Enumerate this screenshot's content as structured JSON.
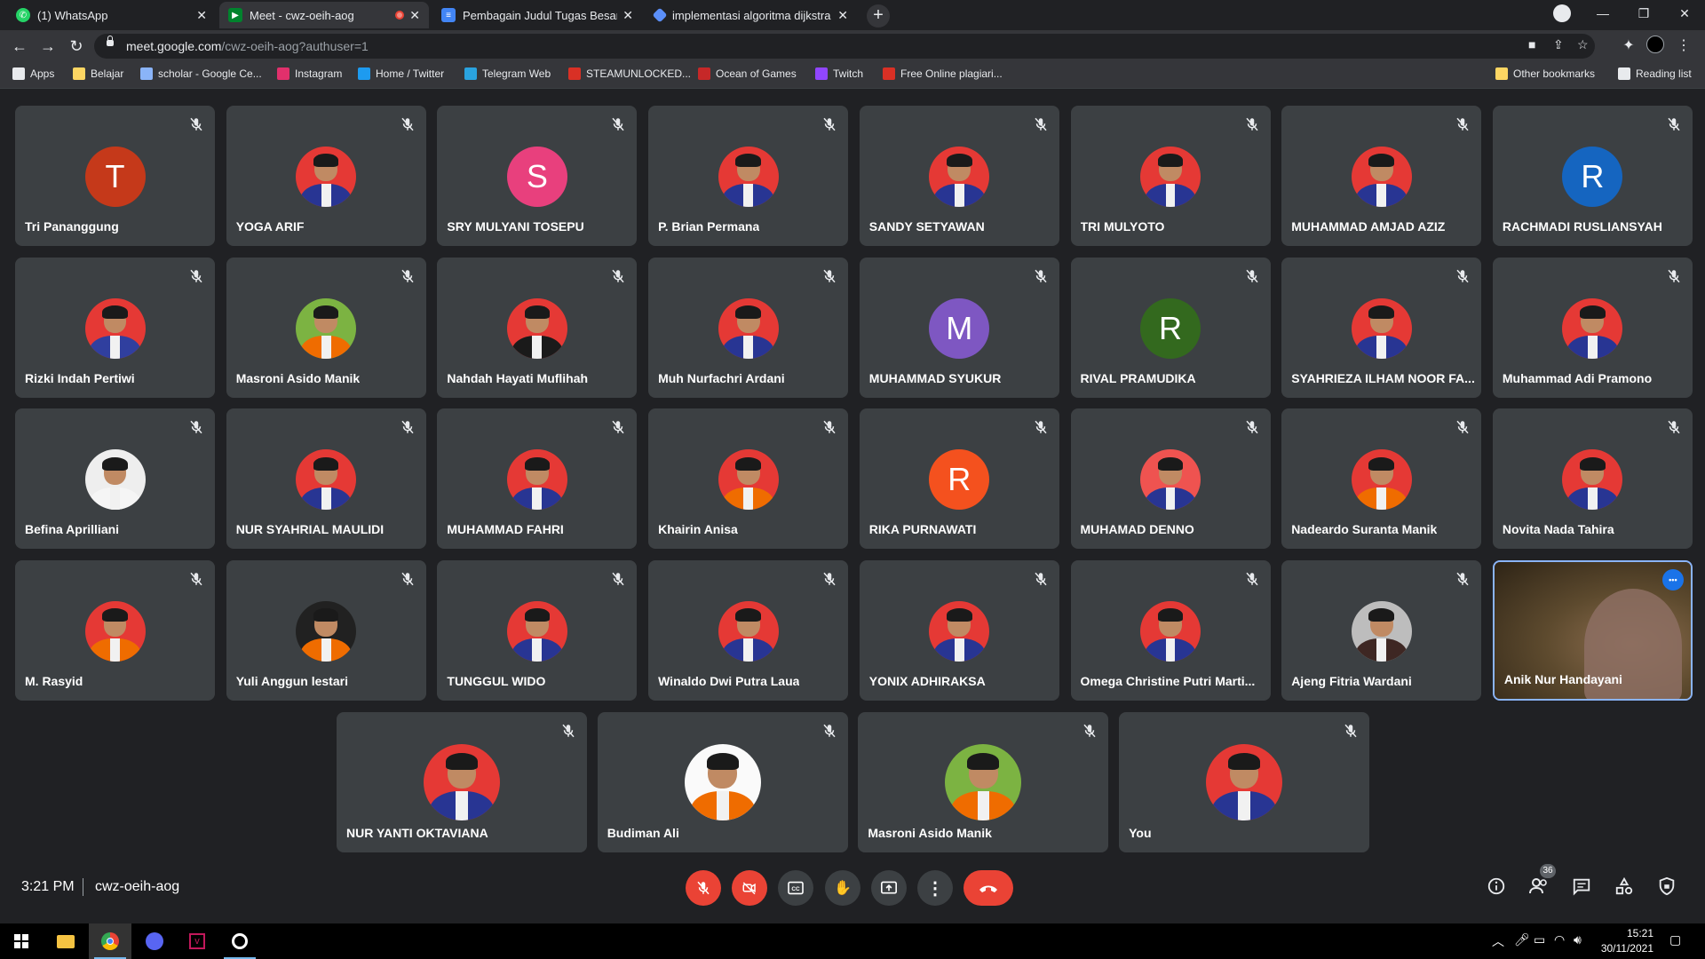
{
  "tabs": [
    {
      "label": "(1) WhatsApp",
      "icon": "whatsapp-icon",
      "color": "#25d366"
    },
    {
      "label": "Meet - cwz-oeih-aog",
      "icon": "meet-icon",
      "color": "#00832d"
    },
    {
      "label": "Pembagain Judul Tugas Besar Ke",
      "icon": "docs-icon",
      "color": "#4285f4"
    },
    {
      "label": "implementasi algoritma dijkstra",
      "icon": "dijkstra-icon",
      "color": "#5b8ff9"
    }
  ],
  "address": {
    "domain": "meet.google.com",
    "path": "/cwz-oeih-aog?authuser=1"
  },
  "bookmarks": [
    {
      "label": "Apps",
      "color": "#e8eaed"
    },
    {
      "label": "Belajar",
      "color": "#fdd663"
    },
    {
      "label": "scholar - Google Ce...",
      "color": "#8ab4f8"
    },
    {
      "label": "Instagram",
      "color": "#e1306c"
    },
    {
      "label": "Home / Twitter",
      "color": "#1d9bf0"
    },
    {
      "label": "Telegram Web",
      "color": "#2aa3df"
    },
    {
      "label": "STEAMUNLOCKED...",
      "color": "#d93025"
    },
    {
      "label": "Ocean of Games",
      "color": "#c62828"
    },
    {
      "label": "Twitch",
      "color": "#9146ff"
    },
    {
      "label": "Free Online plagiari...",
      "color": "#d93025"
    }
  ],
  "bookmarks_right": [
    {
      "label": "Other bookmarks",
      "color": "#fdd663"
    },
    {
      "label": "Reading list",
      "color": "#e8eaed"
    }
  ],
  "participants": [
    {
      "name": "Tri Pananggung",
      "avatar": "letter",
      "letter": "T",
      "color": "#c5391a"
    },
    {
      "name": "YOGA ARIF",
      "avatar": "photo",
      "bg": "#e53935",
      "body": "#283593"
    },
    {
      "name": "SRY MULYANI TOSEPU",
      "avatar": "letter",
      "letter": "S",
      "color": "#e8407d"
    },
    {
      "name": "P. Brian Permana",
      "avatar": "photo",
      "bg": "#e53935",
      "body": "#283593"
    },
    {
      "name": "SANDY SETYAWAN",
      "avatar": "photo",
      "bg": "#e53935",
      "body": "#283593"
    },
    {
      "name": "TRI MULYOTO",
      "avatar": "photo",
      "bg": "#e53935",
      "body": "#283593"
    },
    {
      "name": "MUHAMMAD AMJAD AZIZ",
      "avatar": "photo",
      "bg": "#e53935",
      "body": "#283593"
    },
    {
      "name": "RACHMADI RUSLIANSYAH",
      "avatar": "letter",
      "letter": "R",
      "color": "#1565c0"
    },
    {
      "name": "Rizki Indah Pertiwi",
      "avatar": "photo",
      "bg": "#e53935",
      "body": "#303f9f"
    },
    {
      "name": "Masroni Asido Manik",
      "avatar": "photo",
      "bg": "#7cb342",
      "body": "#ef6c00"
    },
    {
      "name": "Nahdah Hayati Muflihah",
      "avatar": "photo",
      "bg": "#e53935",
      "body": "#1a1a1a"
    },
    {
      "name": "Muh Nurfachri Ardani",
      "avatar": "photo",
      "bg": "#e53935",
      "body": "#283593"
    },
    {
      "name": "MUHAMMAD SYUKUR",
      "avatar": "letter",
      "letter": "M",
      "color": "#7e57c2"
    },
    {
      "name": "RIVAL PRAMUDIKA",
      "avatar": "letter",
      "letter": "R",
      "color": "#33691e"
    },
    {
      "name": "SYAHRIEZA ILHAM NOOR FA...",
      "avatar": "photo",
      "bg": "#e53935",
      "body": "#283593"
    },
    {
      "name": "Muhammad Adi Pramono",
      "avatar": "photo",
      "bg": "#e53935",
      "body": "#283593"
    },
    {
      "name": "Befina Aprilliani",
      "avatar": "photo",
      "bg": "#eeeeee",
      "body": "#f5f5f5"
    },
    {
      "name": "NUR SYAHRIAL MAULIDI",
      "avatar": "photo",
      "bg": "#e53935",
      "body": "#283593"
    },
    {
      "name": "MUHAMMAD FAHRI",
      "avatar": "photo",
      "bg": "#e53935",
      "body": "#283593"
    },
    {
      "name": "Khairin Anisa",
      "avatar": "photo",
      "bg": "#e53935",
      "body": "#ef6c00"
    },
    {
      "name": "RIKA PURNAWATI",
      "avatar": "letter",
      "letter": "R",
      "color": "#f4511e"
    },
    {
      "name": "MUHAMAD DENNO",
      "avatar": "photo",
      "bg": "#ef5350",
      "body": "#283593"
    },
    {
      "name": "Nadeardo Suranta Manik",
      "avatar": "photo",
      "bg": "#e53935",
      "body": "#ef6c00"
    },
    {
      "name": "Novita Nada Tahira",
      "avatar": "photo",
      "bg": "#e53935",
      "body": "#283593"
    },
    {
      "name": "M. Rasyid",
      "avatar": "photo",
      "bg": "#e53935",
      "body": "#ef6c00"
    },
    {
      "name": "Yuli Anggun lestari",
      "avatar": "photo",
      "bg": "#212121",
      "body": "#ef6c00"
    },
    {
      "name": "TUNGGUL WIDO",
      "avatar": "photo",
      "bg": "#e53935",
      "body": "#283593"
    },
    {
      "name": "Winaldo Dwi Putra Laua",
      "avatar": "photo",
      "bg": "#e53935",
      "body": "#283593"
    },
    {
      "name": "YONIX ADHIRAKSA",
      "avatar": "photo",
      "bg": "#e53935",
      "body": "#283593"
    },
    {
      "name": "Omega Christine Putri Marti...",
      "avatar": "photo",
      "bg": "#e53935",
      "body": "#283593"
    },
    {
      "name": "Ajeng Fitria Wardani",
      "avatar": "photo",
      "bg": "#bdbdbd",
      "body": "#3e2723"
    },
    {
      "name": "Anik Nur Handayani",
      "avatar": "video",
      "bg": "#6b5636",
      "body": "#8d6e63"
    },
    {
      "name": "NUR YANTI OKTAVIANA",
      "avatar": "photo",
      "bg": "#e53935",
      "body": "#283593"
    },
    {
      "name": "Budiman Ali",
      "avatar": "photo",
      "bg": "#fafafa",
      "body": "#ef6c00"
    },
    {
      "name": "Masroni Asido Manik",
      "avatar": "photo",
      "bg": "#7cb342",
      "body": "#ef6c00"
    },
    {
      "name": "You",
      "avatar": "photo",
      "bg": "#e53935",
      "body": "#283593"
    }
  ],
  "meeting": {
    "time": "3:21 PM",
    "code": "cwz-oeih-aog",
    "participant_count": "36"
  },
  "taskbar": {
    "time": "15:21",
    "date": "30/11/2021"
  }
}
